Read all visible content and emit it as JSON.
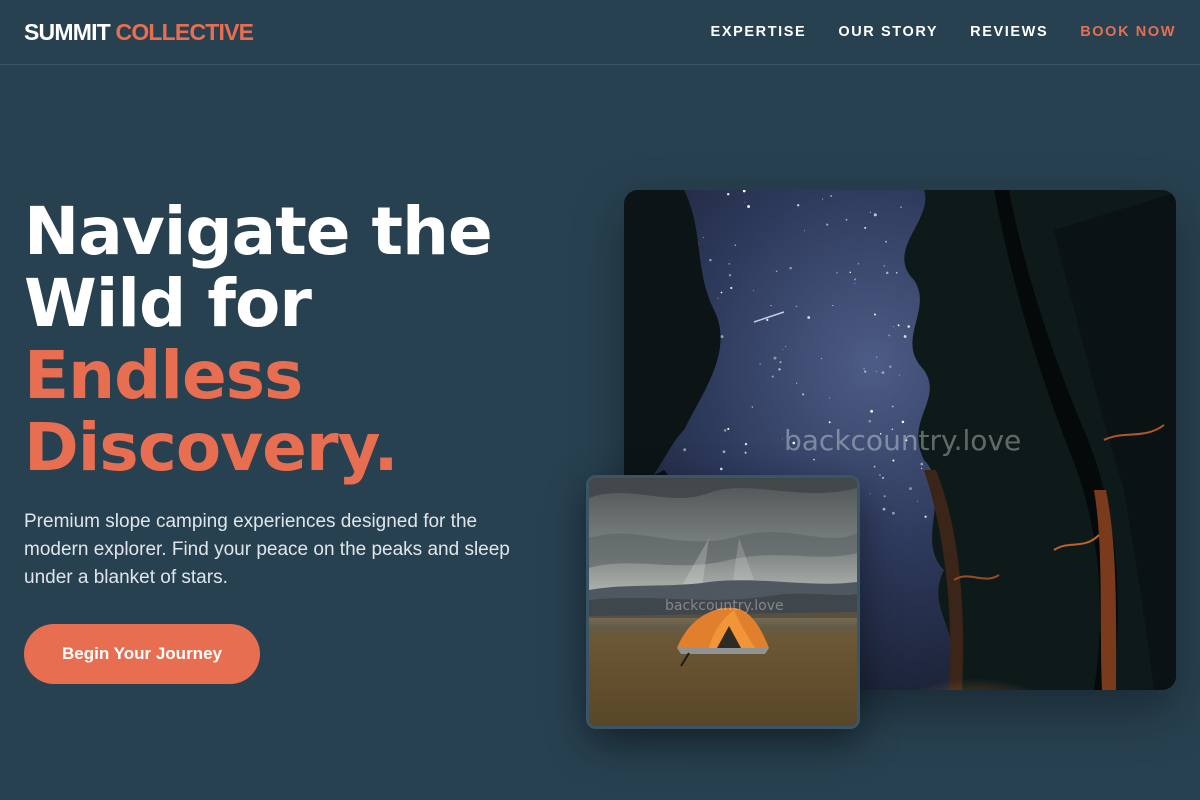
{
  "header": {
    "logo_primary": "SUMMIT",
    "logo_accent": "COLLECTIVE",
    "nav": [
      {
        "label": "EXPERTISE"
      },
      {
        "label": "OUR STORY"
      },
      {
        "label": "REVIEWS"
      },
      {
        "label": "BOOK NOW"
      }
    ]
  },
  "hero": {
    "title_line1": "Navigate the",
    "title_line2": "Wild for",
    "title_accent_line1": "Endless",
    "title_accent_line2": "Discovery.",
    "subtitle": "Premium slope camping experiences designed for the modern explorer. Find your peace on the peaks and sleep under a blanket of stars.",
    "cta_label": "Begin Your Journey"
  },
  "images": {
    "night_watermark": "backcountry.love",
    "tent_watermark": "backcountry.love"
  },
  "colors": {
    "background": "#284150",
    "accent": "#e76e50",
    "text": "#ffffff"
  }
}
